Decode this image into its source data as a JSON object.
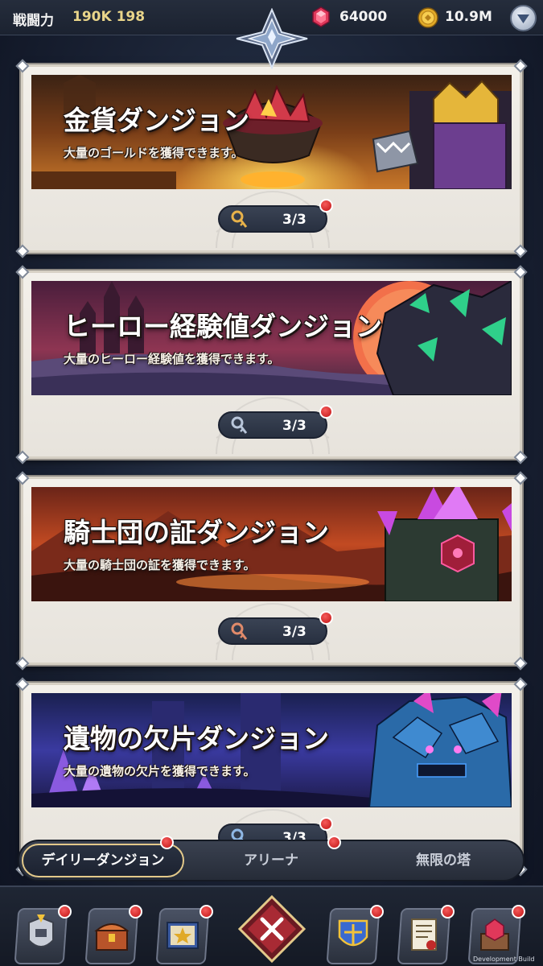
{
  "header": {
    "power_label": "戦闘力",
    "power_value": "190K 198",
    "gems": "64000",
    "gold": "10.9M",
    "icons": [
      "gem-icon",
      "gold-coin-icon",
      "dropdown-menu-icon",
      "crest-emblem-icon"
    ]
  },
  "dungeons": [
    {
      "title": "金貨ダンジョン",
      "description": "大量のゴールドを獲得できます。",
      "keys": "3/3",
      "key_color": "#e8b24a",
      "theme": "gold"
    },
    {
      "title": "ヒーロー経験値ダンジョン",
      "description": "大量のヒーロー経験値を獲得できます。",
      "keys": "3/3",
      "key_color": "#b9c6da",
      "theme": "purple"
    },
    {
      "title": "騎士団の証ダンジョン",
      "description": "大量の騎士団の証を獲得できます。",
      "keys": "3/3",
      "key_color": "#e08a6a",
      "theme": "red"
    },
    {
      "title": "遺物の欠片ダンジョン",
      "description": "大量の遺物の欠片を獲得できます。",
      "keys": "3/3",
      "key_color": "#8fb8e6",
      "theme": "blue"
    }
  ],
  "tabs": {
    "daily": "デイリーダンジョン",
    "arena": "アリーナ",
    "tower": "無限の塔"
  },
  "bottom_nav": {
    "items": [
      "hero-armor-icon",
      "treasure-chest-icon",
      "spellbook-icon",
      "close-icon",
      "guild-shield-icon",
      "quest-scroll-icon",
      "shop-gem-icon"
    ]
  },
  "footer": {
    "build_label": "Development Build"
  },
  "colors": {
    "accent_gold": "#e3c98a",
    "notify_red": "#c11414",
    "card_bg": "#efebe4"
  }
}
